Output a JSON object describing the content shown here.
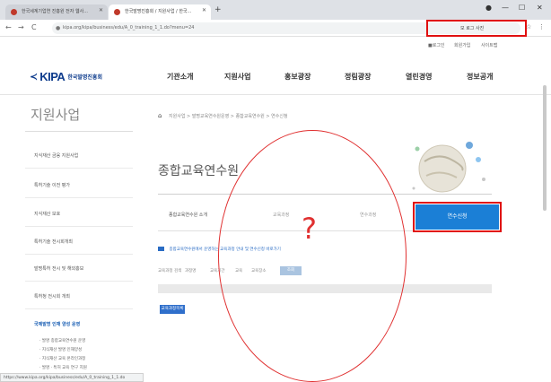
{
  "browser": {
    "tabs": [
      {
        "title": "한국세계기업연 진흥원 전자 웹사..."
      },
      {
        "title": "한국발명진흥회 / 지원사업 / 한국..."
      }
    ],
    "new_tab": "+",
    "window_controls": [
      "●",
      "—",
      "☐",
      "✕"
    ],
    "back": "←",
    "forward": "→",
    "reload": "C",
    "url": "kipa.org/kipa/business/edu/A_0_training_1_1.do?menu=24",
    "user_button": "모 로그 사진",
    "toolbar_icons": {
      "star": "☆",
      "menu": "⋮"
    }
  },
  "site": {
    "util_links": [
      "■로그인",
      "회원가입",
      "사이트맵"
    ],
    "logo": {
      "mark": "≺",
      "brand": "KIPA",
      "brand_kr": "한국발명진흥회"
    },
    "nav": [
      "기관소개",
      "지원사업",
      "홍보광장",
      "정림광장",
      "열린경영",
      "정보공개"
    ],
    "section_title": "지원사업",
    "breadcrumb": {
      "home_icon": "⌂",
      "path": "지원사업 > 발명교육연수원운영 > 종합교육연수원 > 연수신청"
    },
    "sidebar": {
      "items": [
        "지식재산 금융 지원사업",
        "특허기술 이전 평가",
        "지식재산 보호",
        "특허기술 전시회개최",
        "발명특허 전시 및 해외홍보",
        "특허청 전시회 개최",
        "국제발명 인재 양성 운영"
      ],
      "active_index": 6,
      "sub_items": [
        "· 발명 종합교육연수원 운영",
        "· 지식재산 발명 인재양성",
        "· 지식재산 교육 온라인과정",
        "· 발명 · 특허 교육 연구 지원"
      ]
    },
    "content": {
      "title": "종합교육연수원",
      "subtabs": [
        "종합교육연수원 소개",
        "교육과정",
        "연수과정",
        "연수신청"
      ],
      "apply_button": "연수신청",
      "notice": "종합교육연수원에서 운영하는 교육과정 안내 및 연수신청 바로가기",
      "filters": [
        "교육과정 검색",
        "과정명",
        "교육기간",
        "교육",
        "교육장소"
      ],
      "filter_button": "조회",
      "list_button": "교육과정목록"
    },
    "status_url": "https://www.kipa.org/kipa/business/edu/A_0_training_1_1.do"
  },
  "annotation": {
    "question_mark": "?"
  },
  "colors": {
    "brand": "#0d3b8c",
    "accent_blue": "#1b7fd6",
    "highlight_red": "#e01010"
  }
}
